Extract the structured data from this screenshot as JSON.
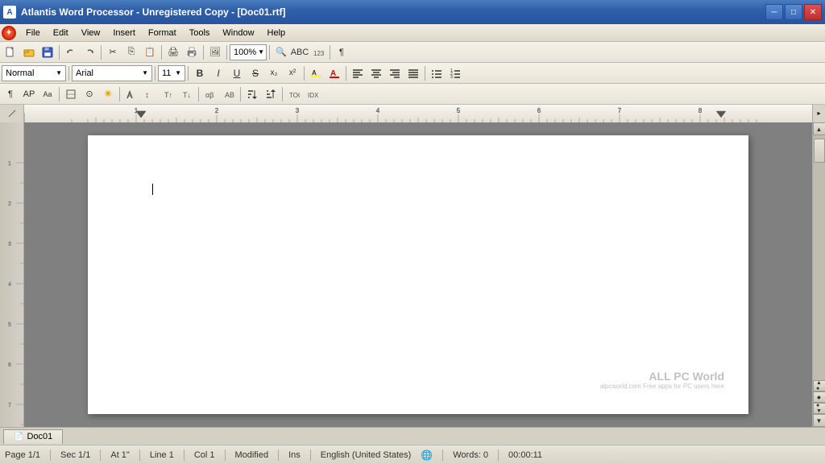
{
  "titleBar": {
    "title": "Atlantis Word Processor - Unregistered Copy - [Doc01.rtf]",
    "appIcon": "A",
    "minBtn": "─",
    "restoreBtn": "□",
    "closeBtn": "✕"
  },
  "menuBar": {
    "items": [
      "File",
      "Edit",
      "View",
      "Insert",
      "Format",
      "Tools",
      "Window",
      "Help"
    ]
  },
  "toolbar1": {
    "zoom": "100%",
    "zoomLabel": "100%"
  },
  "toolbar2": {
    "style": "Normal",
    "font": "Arial",
    "size": "11",
    "boldLabel": "B",
    "italicLabel": "I",
    "underlineLabel": "U"
  },
  "ruler": {
    "labels": [
      "1",
      "2",
      "3",
      "4",
      "5",
      "6",
      "7"
    ]
  },
  "statusBar": {
    "page": "Page 1/1",
    "sec": "Sec 1/1",
    "position": "At 1\"",
    "line": "Line 1",
    "col": "Col 1",
    "modified": "Modified",
    "ins": "Ins",
    "language": "English (United States)",
    "words": "Words: 0",
    "time": "00:00:11"
  },
  "tabBar": {
    "docName": "Doc01"
  },
  "watermark": {
    "line1": "ALL PC World",
    "line2": "alpcworld.com Free apps for PC users here"
  }
}
